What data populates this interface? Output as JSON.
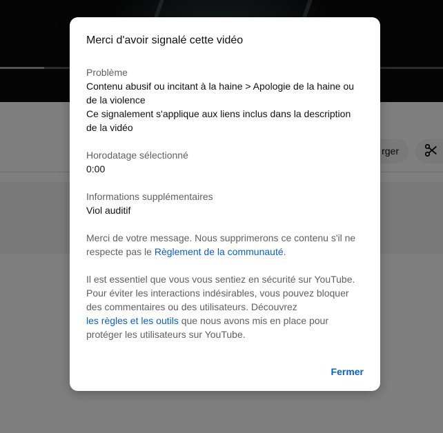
{
  "background": {
    "video_progress_fraction": 0.1,
    "download_label": "rger",
    "clip_icon": "scissors-icon"
  },
  "dialog": {
    "title": "Merci d'avoir signalé cette vidéo",
    "problem": {
      "label": "Problème",
      "value_line1": "Contenu abusif ou incitant à la haine > Apologie de la haine ou de la violence",
      "value_line2": "Ce signalement s'applique aux liens inclus dans la description de la vidéo"
    },
    "timestamp": {
      "label": "Horodatage sélectionné",
      "value": "0:00"
    },
    "additional_info": {
      "label": "Informations supplémentaires",
      "value": "Viol auditif"
    },
    "thanks_message": {
      "text_before": "Merci de votre message. Nous supprimerons ce contenu s'il ne respecte pas le ",
      "link": "Règlement de la communauté",
      "text_after": "."
    },
    "safety_message": {
      "text_before": "Il est essentiel que vous vous sentiez en sécurité sur YouTube. Pour éviter les interactions indésirables, vous pouvez bloquer des commentaires ou des utilisateurs. Découvrez",
      "link": "les règles et les outils",
      "text_after": " que nous avons mis en place pour protéger les utilisateurs sur YouTube."
    },
    "close_label": "Fermer"
  },
  "colors": {
    "link": "#065fd4",
    "secondary_text": "#606060",
    "primary_text": "#0f0f0f"
  }
}
